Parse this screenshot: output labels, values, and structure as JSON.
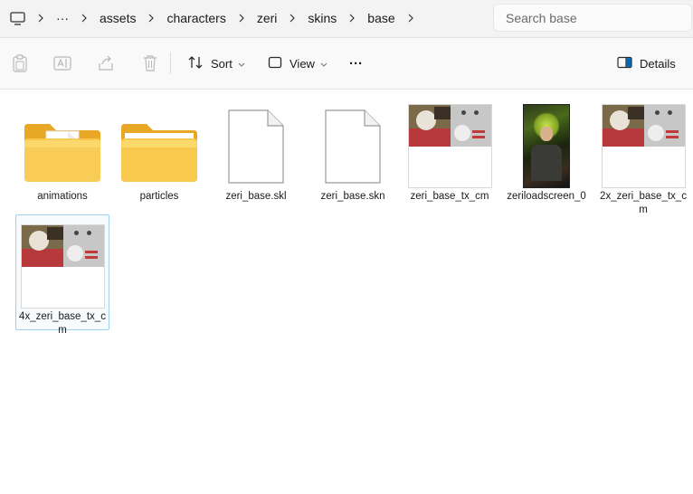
{
  "address": {
    "crumbs": [
      "assets",
      "characters",
      "zeri",
      "skins",
      "base"
    ],
    "overflow_label": "···"
  },
  "search": {
    "placeholder": "Search base"
  },
  "toolbar": {
    "sort_label": "Sort",
    "view_label": "View",
    "more_label": "···",
    "details_label": "Details"
  },
  "items": [
    {
      "label": "animations",
      "type": "folder-with-file"
    },
    {
      "label": "particles",
      "type": "folder"
    },
    {
      "label": "zeri_base.skl",
      "type": "file"
    },
    {
      "label": "zeri_base.skn",
      "type": "file"
    },
    {
      "label": "zeri_base_tx_cm",
      "type": "texture-image"
    },
    {
      "label": "zeriloadscreen_0",
      "type": "loadscreen-image"
    },
    {
      "label": "2x_zeri_base_tx_cm",
      "type": "texture-image"
    },
    {
      "label": "4x_zeri_base_tx_cm",
      "type": "texture-image",
      "selected": true
    }
  ],
  "colors": {
    "accent": "#0067c0",
    "folder": "#f4c046",
    "selection_border": "#9ed0f1"
  }
}
